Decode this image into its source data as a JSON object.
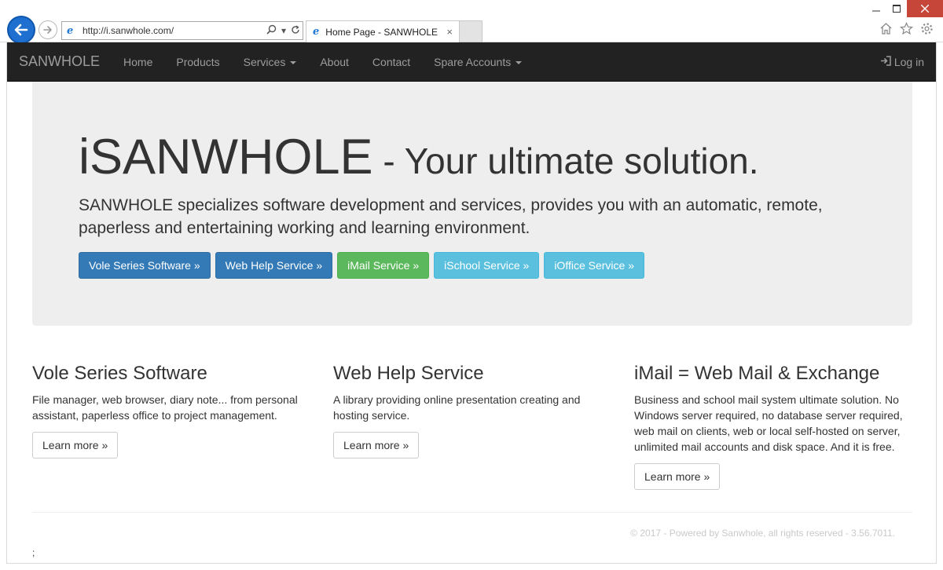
{
  "browser": {
    "url": "http://i.sanwhole.com/",
    "tab_title": "Home Page - SANWHOLE",
    "tab_close": "×"
  },
  "navbar": {
    "brand": "SANWHOLE",
    "items": [
      {
        "label": "Home"
      },
      {
        "label": "Products"
      },
      {
        "label": "Services"
      },
      {
        "label": "About"
      },
      {
        "label": "Contact"
      },
      {
        "label": "Spare Accounts"
      }
    ],
    "login": "Log in"
  },
  "hero": {
    "title_main": "iSANWHOLE",
    "title_rest": " - Your ultimate solution.",
    "lead": "SANWHOLE specializes software development and services, provides you with an automatic, remote, paperless and entertaining working and learning environment.",
    "buttons": [
      {
        "label": "Vole Series Software »"
      },
      {
        "label": "Web Help Service »"
      },
      {
        "label": "iMail Service »"
      },
      {
        "label": "iSchool Service »"
      },
      {
        "label": "iOffice Service »"
      }
    ]
  },
  "features": [
    {
      "heading": "Vole Series Software",
      "text": "File manager, web browser, diary note... from personal assistant, paperless office to project management.",
      "button": "Learn more »"
    },
    {
      "heading": "Web Help Service",
      "text": "A library providing online presentation creating and hosting service.",
      "button": "Learn more »"
    },
    {
      "heading": "iMail = Web Mail & Exchange",
      "text": "Business and school mail system ultimate solution. No Windows server required, no database server required, web mail on clients, web or local self-hosted on server, unlimited mail accounts and disk space. And it is free.",
      "button": "Learn more »"
    }
  ],
  "footer": {
    "text": "© 2017 - Powered by Sanwhole, all rights reserved - 3.56.7011.",
    "stray": ";"
  },
  "colors": {
    "navbar_bg": "#222222",
    "jumbotron_bg": "#eeeeee",
    "primary": "#337ab7",
    "success": "#5cb85c",
    "info": "#5bc0de"
  }
}
